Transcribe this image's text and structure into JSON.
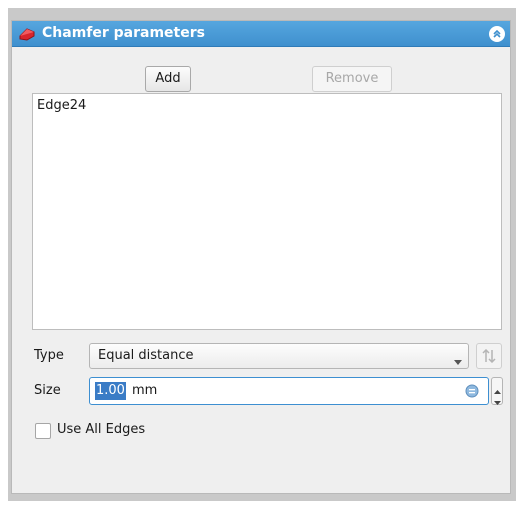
{
  "panel": {
    "title": "Chamfer parameters",
    "accent_color": "#4b9bd8",
    "title_icon": "chamfer-icon",
    "collapse_icon": "collapse-icon"
  },
  "buttons": {
    "add_label": "Add",
    "remove_label": "Remove"
  },
  "edge_list": {
    "items": [
      "Edge24"
    ]
  },
  "type": {
    "label": "Type",
    "selected": "Equal distance",
    "flip_icon": "flip-direction-icon"
  },
  "size": {
    "label": "Size",
    "value": "1.00",
    "unit": "mm",
    "expression_icon": "expression-icon"
  },
  "use_all_edges": {
    "label": "Use All Edges",
    "checked": false
  }
}
